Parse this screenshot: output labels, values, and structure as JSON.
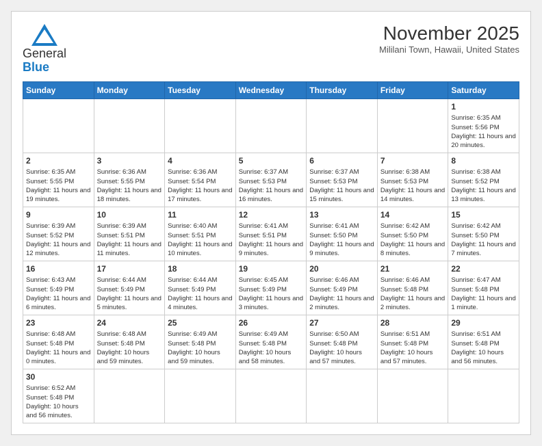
{
  "logo": {
    "line1": "General",
    "line2": "Blue"
  },
  "title": "November 2025",
  "location": "Mililani Town, Hawaii, United States",
  "weekdays": [
    "Sunday",
    "Monday",
    "Tuesday",
    "Wednesday",
    "Thursday",
    "Friday",
    "Saturday"
  ],
  "weeks": [
    [
      {
        "day": "",
        "info": ""
      },
      {
        "day": "",
        "info": ""
      },
      {
        "day": "",
        "info": ""
      },
      {
        "day": "",
        "info": ""
      },
      {
        "day": "",
        "info": ""
      },
      {
        "day": "",
        "info": ""
      },
      {
        "day": "1",
        "info": "Sunrise: 6:35 AM\nSunset: 5:56 PM\nDaylight: 11 hours and 20 minutes."
      }
    ],
    [
      {
        "day": "2",
        "info": "Sunrise: 6:35 AM\nSunset: 5:55 PM\nDaylight: 11 hours and 19 minutes."
      },
      {
        "day": "3",
        "info": "Sunrise: 6:36 AM\nSunset: 5:55 PM\nDaylight: 11 hours and 18 minutes."
      },
      {
        "day": "4",
        "info": "Sunrise: 6:36 AM\nSunset: 5:54 PM\nDaylight: 11 hours and 17 minutes."
      },
      {
        "day": "5",
        "info": "Sunrise: 6:37 AM\nSunset: 5:53 PM\nDaylight: 11 hours and 16 minutes."
      },
      {
        "day": "6",
        "info": "Sunrise: 6:37 AM\nSunset: 5:53 PM\nDaylight: 11 hours and 15 minutes."
      },
      {
        "day": "7",
        "info": "Sunrise: 6:38 AM\nSunset: 5:53 PM\nDaylight: 11 hours and 14 minutes."
      },
      {
        "day": "8",
        "info": "Sunrise: 6:38 AM\nSunset: 5:52 PM\nDaylight: 11 hours and 13 minutes."
      }
    ],
    [
      {
        "day": "9",
        "info": "Sunrise: 6:39 AM\nSunset: 5:52 PM\nDaylight: 11 hours and 12 minutes."
      },
      {
        "day": "10",
        "info": "Sunrise: 6:39 AM\nSunset: 5:51 PM\nDaylight: 11 hours and 11 minutes."
      },
      {
        "day": "11",
        "info": "Sunrise: 6:40 AM\nSunset: 5:51 PM\nDaylight: 11 hours and 10 minutes."
      },
      {
        "day": "12",
        "info": "Sunrise: 6:41 AM\nSunset: 5:51 PM\nDaylight: 11 hours and 9 minutes."
      },
      {
        "day": "13",
        "info": "Sunrise: 6:41 AM\nSunset: 5:50 PM\nDaylight: 11 hours and 9 minutes."
      },
      {
        "day": "14",
        "info": "Sunrise: 6:42 AM\nSunset: 5:50 PM\nDaylight: 11 hours and 8 minutes."
      },
      {
        "day": "15",
        "info": "Sunrise: 6:42 AM\nSunset: 5:50 PM\nDaylight: 11 hours and 7 minutes."
      }
    ],
    [
      {
        "day": "16",
        "info": "Sunrise: 6:43 AM\nSunset: 5:49 PM\nDaylight: 11 hours and 6 minutes."
      },
      {
        "day": "17",
        "info": "Sunrise: 6:44 AM\nSunset: 5:49 PM\nDaylight: 11 hours and 5 minutes."
      },
      {
        "day": "18",
        "info": "Sunrise: 6:44 AM\nSunset: 5:49 PM\nDaylight: 11 hours and 4 minutes."
      },
      {
        "day": "19",
        "info": "Sunrise: 6:45 AM\nSunset: 5:49 PM\nDaylight: 11 hours and 3 minutes."
      },
      {
        "day": "20",
        "info": "Sunrise: 6:46 AM\nSunset: 5:49 PM\nDaylight: 11 hours and 2 minutes."
      },
      {
        "day": "21",
        "info": "Sunrise: 6:46 AM\nSunset: 5:48 PM\nDaylight: 11 hours and 2 minutes."
      },
      {
        "day": "22",
        "info": "Sunrise: 6:47 AM\nSunset: 5:48 PM\nDaylight: 11 hours and 1 minute."
      }
    ],
    [
      {
        "day": "23",
        "info": "Sunrise: 6:48 AM\nSunset: 5:48 PM\nDaylight: 11 hours and 0 minutes."
      },
      {
        "day": "24",
        "info": "Sunrise: 6:48 AM\nSunset: 5:48 PM\nDaylight: 10 hours and 59 minutes."
      },
      {
        "day": "25",
        "info": "Sunrise: 6:49 AM\nSunset: 5:48 PM\nDaylight: 10 hours and 59 minutes."
      },
      {
        "day": "26",
        "info": "Sunrise: 6:49 AM\nSunset: 5:48 PM\nDaylight: 10 hours and 58 minutes."
      },
      {
        "day": "27",
        "info": "Sunrise: 6:50 AM\nSunset: 5:48 PM\nDaylight: 10 hours and 57 minutes."
      },
      {
        "day": "28",
        "info": "Sunrise: 6:51 AM\nSunset: 5:48 PM\nDaylight: 10 hours and 57 minutes."
      },
      {
        "day": "29",
        "info": "Sunrise: 6:51 AM\nSunset: 5:48 PM\nDaylight: 10 hours and 56 minutes."
      }
    ],
    [
      {
        "day": "30",
        "info": "Sunrise: 6:52 AM\nSunset: 5:48 PM\nDaylight: 10 hours and 56 minutes."
      },
      {
        "day": "",
        "info": ""
      },
      {
        "day": "",
        "info": ""
      },
      {
        "day": "",
        "info": ""
      },
      {
        "day": "",
        "info": ""
      },
      {
        "day": "",
        "info": ""
      },
      {
        "day": "",
        "info": ""
      }
    ]
  ]
}
